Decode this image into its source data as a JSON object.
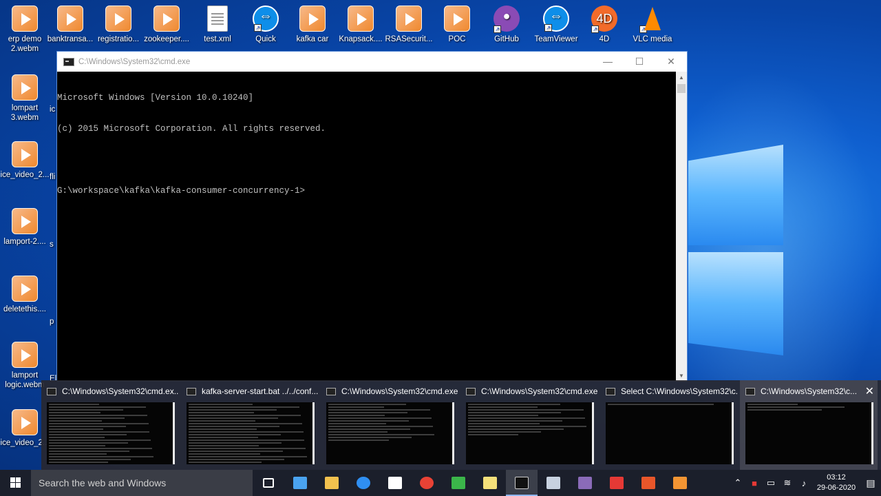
{
  "desktop": {
    "icons_top": [
      {
        "label": "erp demo\n2.webm",
        "kind": "vlc"
      },
      {
        "label": "banktransa...",
        "kind": "vlc"
      },
      {
        "label": "registratio...",
        "kind": "vlc"
      },
      {
        "label": "zookeeper....",
        "kind": "vlc"
      },
      {
        "label": "test.xml",
        "kind": "doc"
      },
      {
        "label": "Quick",
        "kind": "tv"
      },
      {
        "label": "kafka car",
        "kind": "vlc"
      },
      {
        "label": "Knapsack....",
        "kind": "vlc"
      },
      {
        "label": "RSASecurit...",
        "kind": "vlc"
      },
      {
        "label": "POC",
        "kind": "vlc"
      },
      {
        "label": "GitHub",
        "kind": "git"
      },
      {
        "label": "TeamViewer",
        "kind": "tv"
      },
      {
        "label": "4D",
        "kind": "fourd"
      },
      {
        "label": "VLC media",
        "kind": "cone"
      }
    ],
    "icons_left": [
      {
        "label": "lompart\n3.webm"
      },
      {
        "label": "ice_video_2..."
      },
      {
        "label": "lamport-2...."
      },
      {
        "label": "deletethis...."
      },
      {
        "label": "lamport\nlogic.webm"
      },
      {
        "label": "ice_video_2..."
      }
    ],
    "partial_labels": [
      "ic",
      "fli",
      "s",
      "p",
      "El"
    ]
  },
  "cmd_window": {
    "title": "C:\\Windows\\System32\\cmd.exe",
    "minimize": "—",
    "maximize": "☐",
    "close": "✕",
    "lines": [
      "Microsoft Windows [Version 10.0.10240]",
      "(c) 2015 Microsoft Corporation. All rights reserved.",
      "",
      "G:\\workspace\\kafka\\kafka-consumer-concurrency-1>"
    ]
  },
  "thumbnails": [
    {
      "title": "C:\\Windows\\System32\\cmd.ex..."
    },
    {
      "title": "kafka-server-start.bat  ../../conf..."
    },
    {
      "title": "C:\\Windows\\System32\\cmd.exe"
    },
    {
      "title": "C:\\Windows\\System32\\cmd.exe"
    },
    {
      "title": "Select C:\\Windows\\System32\\c..."
    },
    {
      "title": "C:\\Windows\\System32\\c..."
    }
  ],
  "taskbar": {
    "search_placeholder": "Search the web and Windows",
    "apps": [
      {
        "name": "task-view",
        "color": "#ffffff"
      },
      {
        "name": "store-window",
        "color": "#4aa3f0"
      },
      {
        "name": "file-explorer",
        "color": "#f2c14e"
      },
      {
        "name": "edge",
        "color": "#2f8ff2"
      },
      {
        "name": "store",
        "color": "#ffffff"
      },
      {
        "name": "chrome",
        "color": "#e94235"
      },
      {
        "name": "chart-app",
        "color": "#3bb54a"
      },
      {
        "name": "folder-app",
        "color": "#f5e07a"
      },
      {
        "name": "cmd",
        "color": "#111111"
      },
      {
        "name": "notes-app",
        "color": "#c8d2e0"
      },
      {
        "name": "tool-app",
        "color": "#8a6bb8"
      },
      {
        "name": "acrobat",
        "color": "#e53935"
      },
      {
        "name": "presentation-app",
        "color": "#e8562a"
      },
      {
        "name": "vlc-app",
        "color": "#f39533"
      }
    ],
    "time": "03:12",
    "date": "29-06-2020"
  }
}
